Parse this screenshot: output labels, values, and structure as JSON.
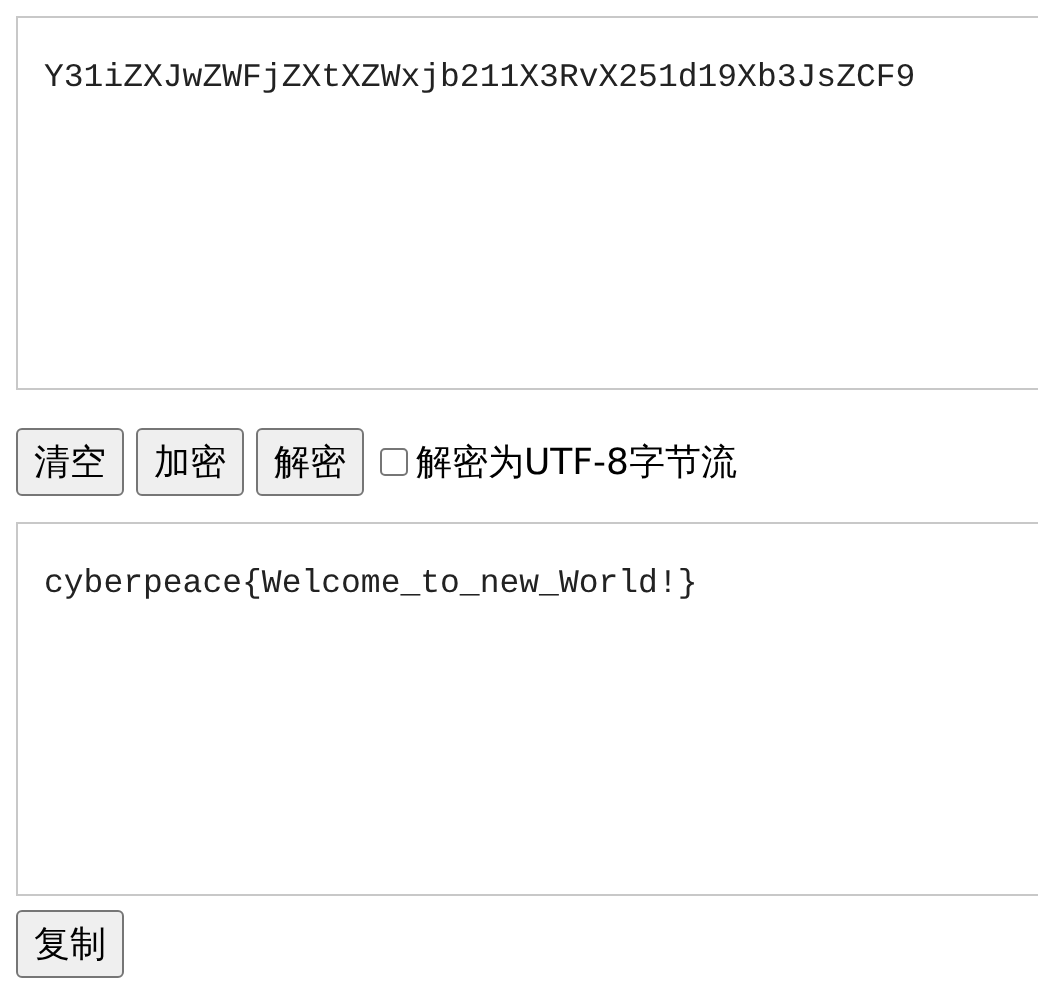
{
  "input": {
    "value": "Y31iZXJwZWFjZXtXZWxjb211X3RvX251d19Xb3JsZCF9"
  },
  "buttons": [
    "清空",
    "加密",
    "解密"
  ],
  "utf8_option": {
    "label": "解密为UTF-8字节流",
    "checked": false
  },
  "output": {
    "value": "cyberpeace{Welcome_to_new_World!}"
  },
  "copy_button": "复制"
}
